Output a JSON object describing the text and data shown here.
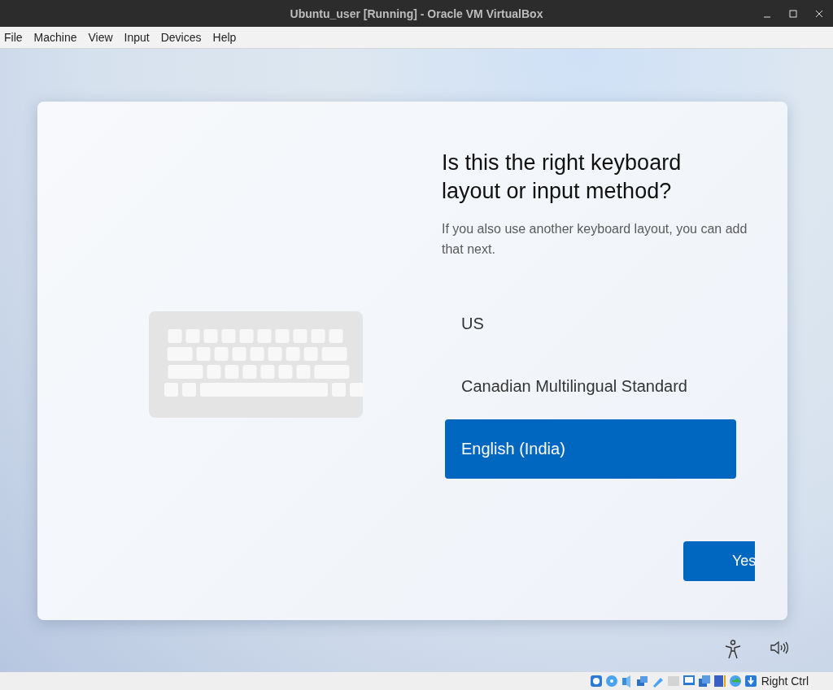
{
  "window": {
    "title": "Ubuntu_user [Running] - Oracle VM VirtualBox"
  },
  "menu": [
    "File",
    "Machine",
    "View",
    "Input",
    "Devices",
    "Help"
  ],
  "setup": {
    "heading": "Is this the right keyboard layout or input method?",
    "subtitle": "If you also use another keyboard layout, you can add that next.",
    "options": [
      {
        "label": "US",
        "selected": false
      },
      {
        "label": "Canadian Multilingual Standard",
        "selected": false
      },
      {
        "label": "English (India)",
        "selected": true
      }
    ],
    "primary_button": "Yes"
  },
  "status_bar": {
    "host_key": "Right Ctrl"
  }
}
